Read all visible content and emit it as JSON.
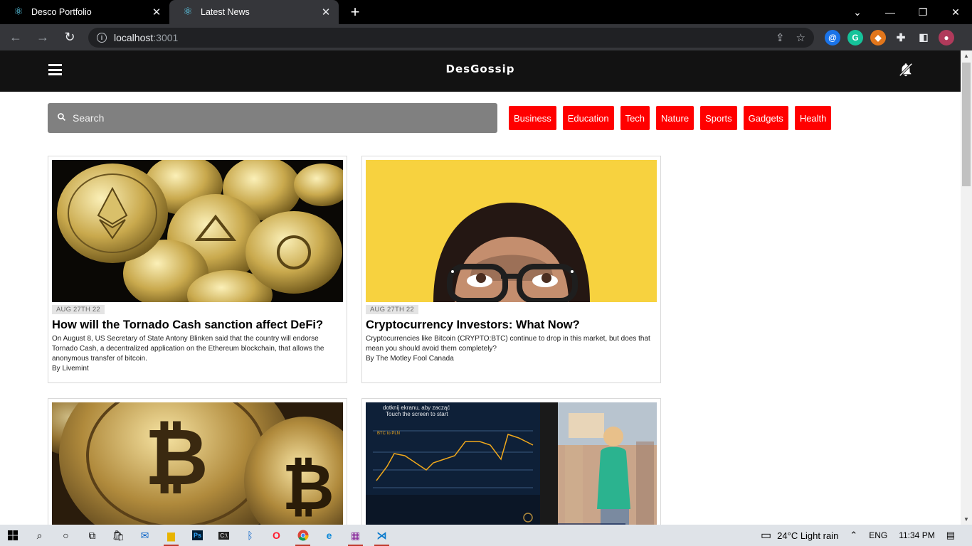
{
  "browser": {
    "tabs": [
      {
        "title": "Desco Portfolio",
        "icon": "react-icon",
        "active": false
      },
      {
        "title": "Latest News",
        "icon": "react-icon",
        "active": true
      }
    ],
    "url_host": "localhost",
    "url_port": ":3001"
  },
  "header": {
    "brand": "DesGossip",
    "menu_icon": "hamburger-icon",
    "notification_icon": "bell-off-icon"
  },
  "search": {
    "placeholder": "Search"
  },
  "categories": [
    "Business",
    "Education",
    "Tech",
    "Nature",
    "Sports",
    "Gadgets",
    "Health"
  ],
  "articles": [
    {
      "image": "ethereum-coins",
      "date": "AUG 27TH 22",
      "title": "How will the Tornado Cash sanction affect DeFi?",
      "description": "On August 8, US Secretary of State Antony Blinken said that the country will endorse Tornado Cash, a decentralized application on the Ethereum blockchain, that allows the anonymous transfer of bitcoin.",
      "byline": "By Livemint"
    },
    {
      "image": "woman-glasses-yellow",
      "date": "AUG 27TH 22",
      "title": "Cryptocurrency Investors: What Now?",
      "description": "Cryptocurrencies like Bitcoin (CRYPTO:BTC) continue to drop in this market, but does that mean you should avoid them completely?",
      "byline": "By The Motley Fool Canada"
    },
    {
      "image": "bitcoin-coins"
    },
    {
      "image": "crypto-atm-chart",
      "atm_text_1": "dotknij ekranu, aby zacząć",
      "atm_text_2": "Touch the screen to start",
      "atm_label": "BTC to PLN"
    }
  ],
  "taskbar": {
    "weather": "24°C  Light rain",
    "lang": "ENG",
    "time": "11:34 PM"
  }
}
